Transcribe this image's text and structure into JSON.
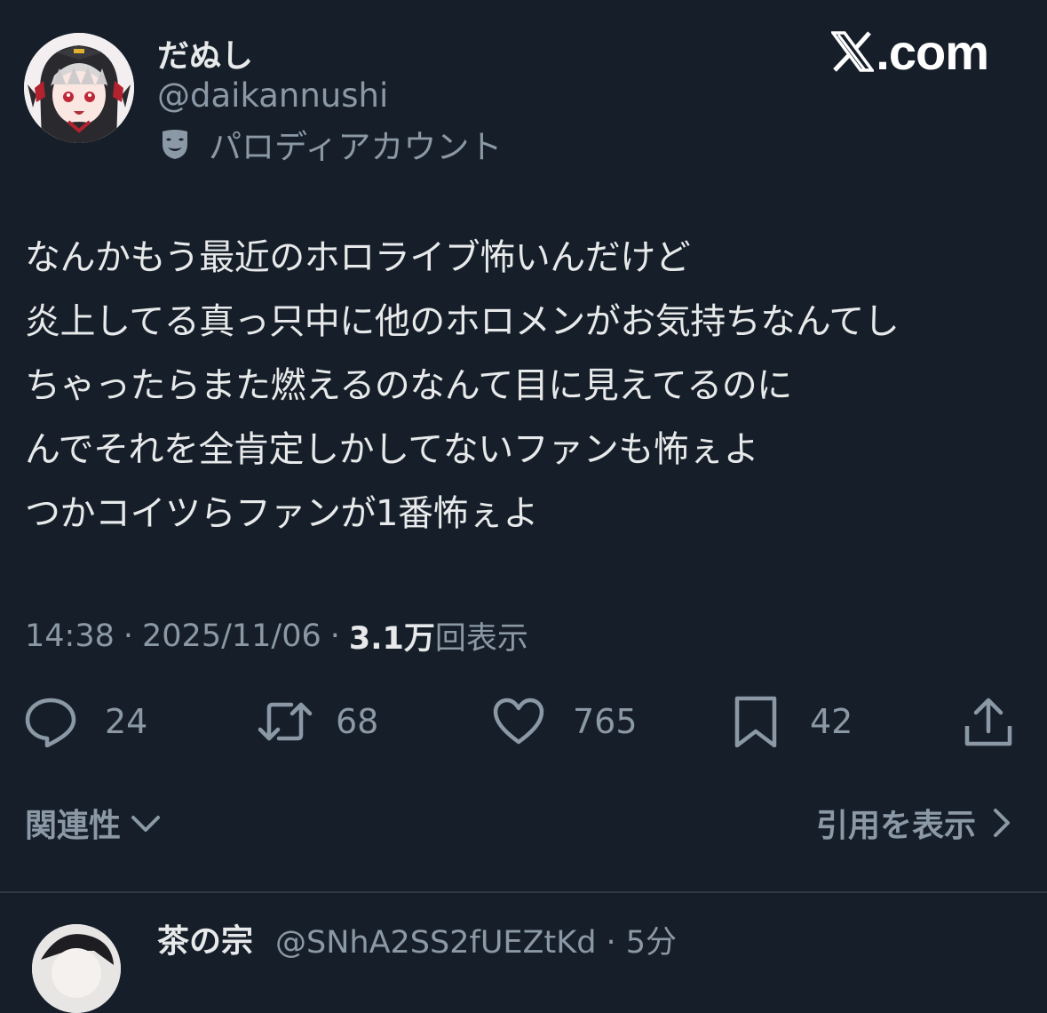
{
  "tweet": {
    "author": {
      "display_name": "だぬし",
      "handle": "@daikannushi",
      "parody_label": "パロディアカウント",
      "parody_icon": "theater-mask-icon"
    },
    "site_logo": {
      "mark": "X",
      "suffix": ".com"
    },
    "body_lines": [
      "なんかもう最近のホロライブ怖いんだけど",
      "炎上してる真っ只中に他のホロメンがお気持ちなんてし",
      "ちゃったらまた燃えるのなんて目に見えてるのに",
      "んでそれを全肯定しかしてないファンも怖ぇよ",
      "つかコイツらファンが1番怖ぇよ"
    ],
    "meta": {
      "time": "14:38",
      "date": "2025/11/06",
      "separator": "·",
      "views_count": "3.1万",
      "views_label": "回表示"
    },
    "actions": {
      "reply_count": "24",
      "retweet_count": "68",
      "like_count": "765",
      "bookmark_count": "42"
    },
    "footer": {
      "related_label": "関連性",
      "quotes_label": "引用を表示"
    }
  },
  "next_reply": {
    "display_name": "茶の宗",
    "handle": "@SNhA2SS2fUEZtKd · 5分"
  },
  "colors": {
    "background": "#161f29",
    "text_primary": "#e7e9ea",
    "text_secondary": "#8b98a5",
    "divider": "#2f3943"
  }
}
